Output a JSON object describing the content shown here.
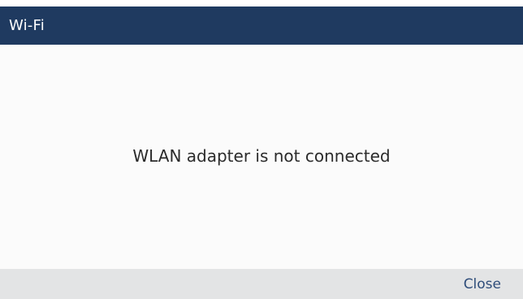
{
  "window": {
    "title": "Wi-Fi"
  },
  "main": {
    "message": "WLAN adapter is not connected"
  },
  "softkeys": {
    "close_label": "Close"
  },
  "colors": {
    "title_bar_bg": "#1f3a60",
    "title_text": "#ffffff",
    "content_bg": "#fbfbfb",
    "softkey_bar_bg": "#e3e4e5",
    "softkey_text": "#2f4d7a"
  }
}
